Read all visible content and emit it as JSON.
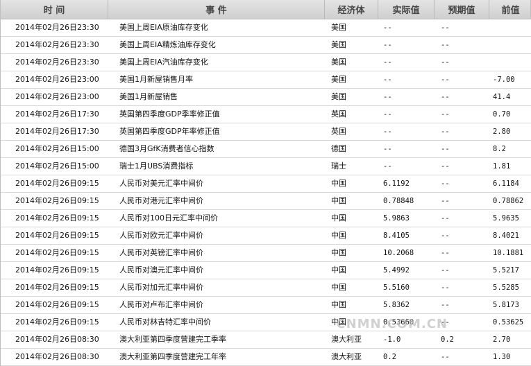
{
  "table": {
    "headers": [
      "时 间",
      "事 件",
      "经济体",
      "实际值",
      "预期值",
      "前值"
    ],
    "rows": [
      {
        "time": "2014年02月26日23:30",
        "event": "美国上周EIA原油库存变化",
        "economy": "美国",
        "actual": "--",
        "forecast": "--",
        "previous": ""
      },
      {
        "time": "2014年02月26日23:30",
        "event": "美国上周EIA精炼油库存变化",
        "economy": "美国",
        "actual": "--",
        "forecast": "--",
        "previous": ""
      },
      {
        "time": "2014年02月26日23:30",
        "event": "美国上周EIA汽油库存变化",
        "economy": "美国",
        "actual": "--",
        "forecast": "--",
        "previous": ""
      },
      {
        "time": "2014年02月26日23:00",
        "event": "美国1月新屋销售月率",
        "economy": "美国",
        "actual": "--",
        "forecast": "--",
        "previous": "-7.00"
      },
      {
        "time": "2014年02月26日23:00",
        "event": "美国1月新屋销售",
        "economy": "美国",
        "actual": "--",
        "forecast": "--",
        "previous": "41.4"
      },
      {
        "time": "2014年02月26日17:30",
        "event": "英国第四季度GDP季率修正值",
        "economy": "英国",
        "actual": "--",
        "forecast": "--",
        "previous": "0.70"
      },
      {
        "time": "2014年02月26日17:30",
        "event": "英国第四季度GDP年率修正值",
        "economy": "英国",
        "actual": "--",
        "forecast": "--",
        "previous": "2.80"
      },
      {
        "time": "2014年02月26日15:00",
        "event": "德国3月GfK消费者信心指数",
        "economy": "德国",
        "actual": "--",
        "forecast": "--",
        "previous": "8.2"
      },
      {
        "time": "2014年02月26日15:00",
        "event": "瑞士1月UBS消费指标",
        "economy": "瑞士",
        "actual": "--",
        "forecast": "--",
        "previous": "1.81"
      },
      {
        "time": "2014年02月26日09:15",
        "event": "人民币对美元汇率中间价",
        "economy": "中国",
        "actual": "6.1192",
        "forecast": "--",
        "previous": "6.1184"
      },
      {
        "time": "2014年02月26日09:15",
        "event": "人民币对港元汇率中间价",
        "economy": "中国",
        "actual": "0.78848",
        "forecast": "--",
        "previous": "0.78862"
      },
      {
        "time": "2014年02月26日09:15",
        "event": "人民币对100日元汇率中间价",
        "economy": "中国",
        "actual": "5.9863",
        "forecast": "--",
        "previous": "5.9635"
      },
      {
        "time": "2014年02月26日09:15",
        "event": "人民币对欧元汇率中间价",
        "economy": "中国",
        "actual": "8.4105",
        "forecast": "--",
        "previous": "8.4021"
      },
      {
        "time": "2014年02月26日09:15",
        "event": "人民币对英镑汇率中间价",
        "economy": "中国",
        "actual": "10.2068",
        "forecast": "--",
        "previous": "10.1881"
      },
      {
        "time": "2014年02月26日09:15",
        "event": "人民币对澳元汇率中间价",
        "economy": "中国",
        "actual": "5.4992",
        "forecast": "--",
        "previous": "5.5217"
      },
      {
        "time": "2014年02月26日09:15",
        "event": "人民币对加元汇率中间价",
        "economy": "中国",
        "actual": "5.5160",
        "forecast": "--",
        "previous": "5.5285"
      },
      {
        "time": "2014年02月26日09:15",
        "event": "人民币对卢布汇率中间价",
        "economy": "中国",
        "actual": "5.8362",
        "forecast": "--",
        "previous": "5.8173"
      },
      {
        "time": "2014年02月26日09:15",
        "event": "人民币对林吉特汇率中间价",
        "economy": "中国",
        "actual": "0.53660",
        "forecast": "--",
        "previous": "0.53625"
      },
      {
        "time": "2014年02月26日08:30",
        "event": "澳大利亚第四季度营建完工季率",
        "economy": "澳大利亚",
        "actual": "-1.0",
        "forecast": "0.2",
        "previous": "2.70"
      },
      {
        "time": "2014年02月26日08:30",
        "event": "澳大利亚第四季度营建完工年率",
        "economy": "澳大利亚",
        "actual": "0.2",
        "forecast": "--",
        "previous": "1.30"
      }
    ]
  },
  "watermark": "CNMN.COM.CN"
}
